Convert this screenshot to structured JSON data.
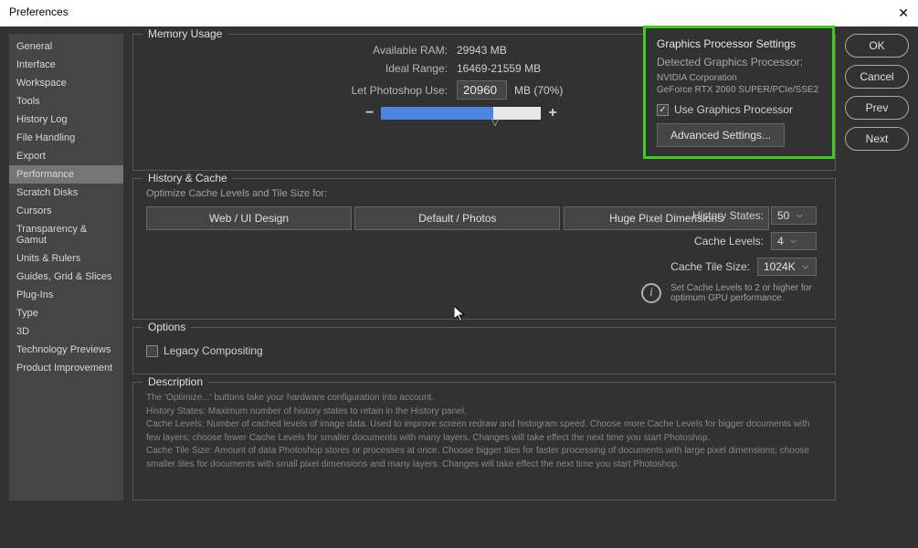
{
  "title": "Preferences",
  "sidebar": {
    "items": [
      {
        "label": "General"
      },
      {
        "label": "Interface"
      },
      {
        "label": "Workspace"
      },
      {
        "label": "Tools"
      },
      {
        "label": "History Log"
      },
      {
        "label": "File Handling"
      },
      {
        "label": "Export"
      },
      {
        "label": "Performance",
        "selected": true
      },
      {
        "label": "Scratch Disks"
      },
      {
        "label": "Cursors"
      },
      {
        "label": "Transparency & Gamut"
      },
      {
        "label": "Units & Rulers"
      },
      {
        "label": "Guides, Grid & Slices"
      },
      {
        "label": "Plug-Ins"
      },
      {
        "label": "Type"
      },
      {
        "label": "3D"
      },
      {
        "label": "Technology Previews"
      },
      {
        "label": "Product Improvement"
      }
    ]
  },
  "memory": {
    "section_title": "Memory Usage",
    "available_label": "Available RAM:",
    "available_value": "29943 MB",
    "ideal_label": "Ideal Range:",
    "ideal_value": "16469-21559 MB",
    "use_label": "Let Photoshop Use:",
    "use_value": "20960",
    "use_suffix": "MB (70%)",
    "minus": "−",
    "plus": "+"
  },
  "gpu": {
    "title": "Graphics Processor Settings",
    "detected_label": "Detected Graphics Processor:",
    "vendor": "NVIDIA Corporation",
    "model": "GeForce RTX 2060 SUPER/PCIe/SSE2",
    "use_label": "Use Graphics Processor",
    "advanced_btn": "Advanced Settings..."
  },
  "history": {
    "section_title": "History & Cache",
    "optimize_label": "Optimize Cache Levels and Tile Size for:",
    "btn1": "Web / UI Design",
    "btn2": "Default / Photos",
    "btn3": "Huge Pixel Dimensions",
    "states_label": "History States:",
    "states_value": "50",
    "levels_label": "Cache Levels:",
    "levels_value": "4",
    "tile_label": "Cache Tile Size:",
    "tile_value": "1024K",
    "hint": "Set Cache Levels to 2 or higher for optimum GPU performance."
  },
  "options": {
    "section_title": "Options",
    "legacy_label": "Legacy Compositing"
  },
  "description": {
    "section_title": "Description",
    "line1": "The 'Optimize...' buttons take your hardware configuration into account.",
    "line2": "History States: Maximum number of history states to retain in the History panel.",
    "line3": "Cache Levels: Number of cached levels of image data.  Used to improve screen redraw and histogram speed.  Choose more Cache Levels for bigger documents with few layers; choose fewer Cache Levels for smaller documents with many layers. Changes will take effect the next time you start Photoshop.",
    "line4": "Cache Tile Size: Amount of data Photoshop stores or processes at once. Choose bigger tiles for faster processing of documents with large pixel dimensions; choose smaller tiles for documents with small pixel dimensions and many layers. Changes will take effect the next time you start Photoshop."
  },
  "buttons": {
    "ok": "OK",
    "cancel": "Cancel",
    "prev": "Prev",
    "next": "Next"
  }
}
